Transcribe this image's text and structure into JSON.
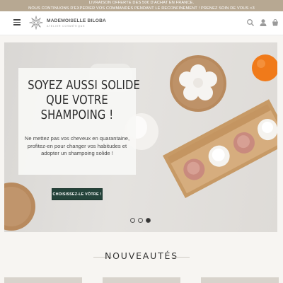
{
  "announcement": {
    "line1": "LIVRAISON OFFERTE DÈS 50€ D'ACHAT EN FRANCE.",
    "line2": "NOUS CONTINUONS D'EXPÉDIER VOS COMMANDES PENDANT LE RECONFINEMENT ! PRENEZ SOIN DE VOUS <3"
  },
  "header": {
    "brand_name": "MADEMOISELLE BILOBA",
    "brand_tagline": "ATELIER COSMÉTIQUE",
    "icons": [
      "menu-icon",
      "search-icon",
      "user-icon",
      "cart-icon"
    ]
  },
  "hero": {
    "title_lines": [
      "SOYEZ AUSSI SOLIDE",
      "QUE VOTRE",
      "SHAMPOING !"
    ],
    "text": "Ne mettez pas vos cheveux en quarantaine, profitez-en pour changer vos habitudes et adopter un shampoing solide !",
    "cta_label": "CHOISISSEZ-LE VÔTRE !",
    "slides_total": 3,
    "active_slide": 3
  },
  "section": {
    "title": "NOUVEAUTÉS"
  },
  "colors": {
    "accent": "#24433a",
    "announcement_bg": "#b7a892",
    "orange": "#f07a1a",
    "cork": "#b88a5e"
  }
}
